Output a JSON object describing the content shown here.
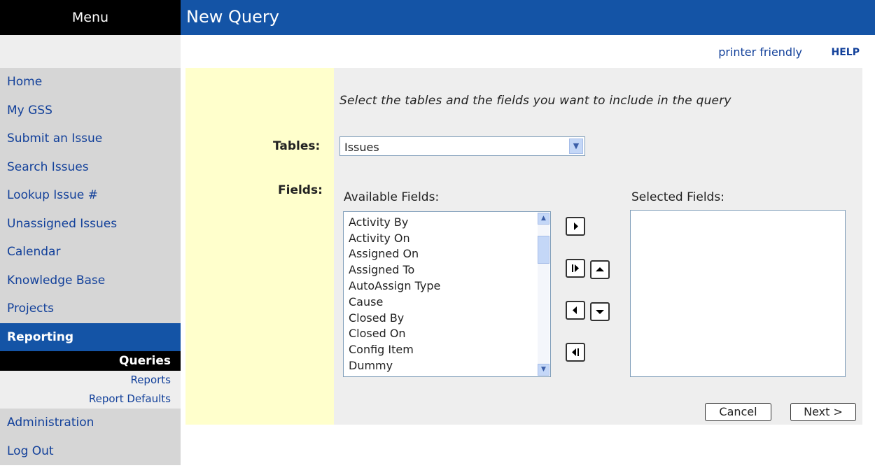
{
  "menu": {
    "title": "Menu",
    "items": [
      {
        "label": "Home"
      },
      {
        "label": "My GSS"
      },
      {
        "label": "Submit an Issue"
      },
      {
        "label": "Search Issues"
      },
      {
        "label": "Lookup Issue #"
      },
      {
        "label": "Unassigned Issues"
      },
      {
        "label": "Calendar"
      },
      {
        "label": "Knowledge Base"
      },
      {
        "label": "Projects"
      },
      {
        "label": "Reporting"
      },
      {
        "label": "Administration"
      },
      {
        "label": "Log Out"
      }
    ],
    "active_item": "Reporting",
    "sub_items": [
      {
        "label": "Queries"
      },
      {
        "label": "Reports"
      },
      {
        "label": "Report Defaults"
      }
    ],
    "active_sub_item": "Queries"
  },
  "header": {
    "title": "New Query",
    "printer_friendly": "printer friendly",
    "help": "HELP"
  },
  "form": {
    "instruction": "Select the tables and the fields you want to include in the query",
    "tables_label": "Tables:",
    "tables_value": "Issues",
    "fields_label": "Fields:",
    "available_label": "Available Fields:",
    "selected_label": "Selected Fields:",
    "available_fields": [
      "Activity By",
      "Activity On",
      "Assigned On",
      "Assigned To",
      "AutoAssign Type",
      "Cause",
      "Closed By",
      "Closed On",
      "Config Item",
      "Dummy"
    ],
    "selected_fields": [],
    "cancel_label": "Cancel",
    "next_label": "Next >"
  },
  "icons": {
    "add": "arrow-right-icon",
    "add_all": "arrow-right-all-icon",
    "remove": "arrow-left-icon",
    "remove_all": "arrow-left-all-icon",
    "move_up": "arrow-up-icon",
    "move_down": "arrow-down-icon"
  },
  "colors": {
    "header_blue": "#1454a6",
    "menu_black": "#000000",
    "nav_gray": "#d6d6d6",
    "left_panel": "#ffffcc",
    "right_panel": "#eeeeee",
    "link_blue": "#12409a"
  }
}
